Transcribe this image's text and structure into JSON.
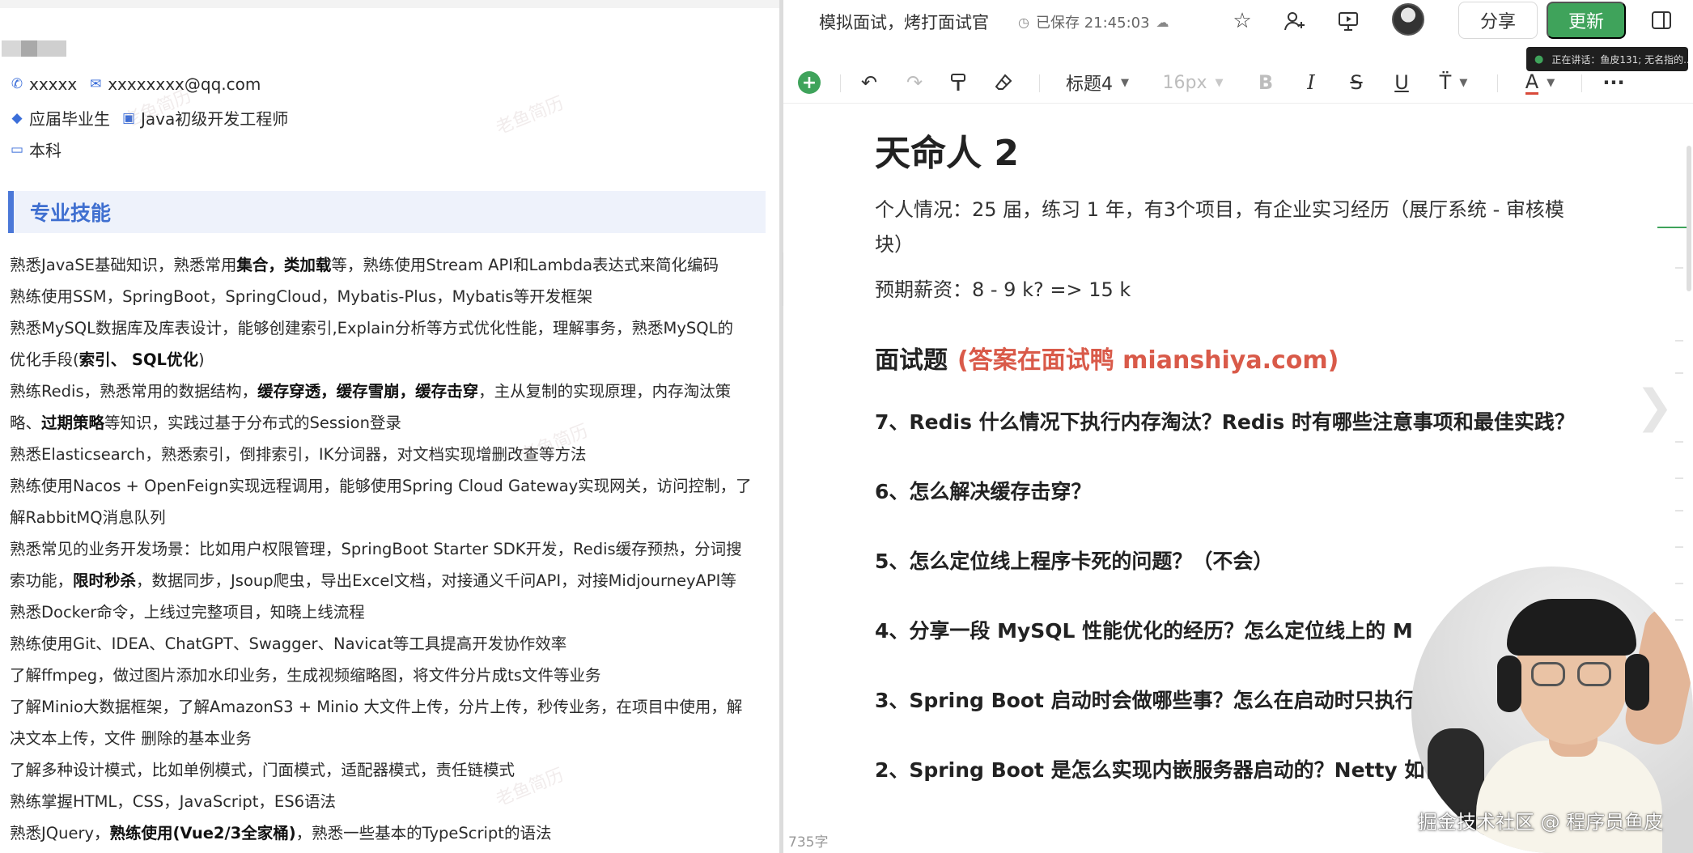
{
  "resume": {
    "contact": {
      "phone": "xxxxx",
      "email": "xxxxxxxx@qq.com",
      "status": "应届毕业生",
      "job_title": "Java初级开发工程师",
      "education": "本科"
    },
    "section_title": "专业技能",
    "watermark": "老鱼简历",
    "skills": [
      [
        {
          "t": "熟悉JavaSE基础知识，熟悉常用"
        },
        {
          "t": "集合，类加载",
          "b": true
        },
        {
          "t": "等，熟练使用Stream API和Lambda表达式来简化编码"
        }
      ],
      [
        {
          "t": "熟练使用SSM，SpringBoot，SpringCloud，Mybatis-Plus，Mybatis等开发框架"
        }
      ],
      [
        {
          "t": "熟悉MySQL数据库及库表设计，能够创建索引,Explain分析等方式优化性能，理解事务，熟悉MySQL的"
        }
      ],
      [
        {
          "t": "优化手段("
        },
        {
          "t": "索引、 SQL优化",
          "b": true
        },
        {
          "t": ")"
        }
      ],
      [
        {
          "t": "熟练Redis，熟悉常用的数据结构，"
        },
        {
          "t": "缓存穿透，缓存雪崩，缓存击穿",
          "b": true
        },
        {
          "t": "，主从复制的实现原理，内存淘汰策"
        }
      ],
      [
        {
          "t": "略、"
        },
        {
          "t": "过期策略",
          "b": true
        },
        {
          "t": "等知识，实践过基于分布式的Session登录"
        }
      ],
      [
        {
          "t": "熟悉Elasticsearch，熟悉索引，倒排索引，IK分词器，对文档实现增删改查等方法"
        }
      ],
      [
        {
          "t": "熟练使用Nacos + OpenFeign实现远程调用，能够使用Spring Cloud Gateway实现网关，访问控制，了"
        }
      ],
      [
        {
          "t": "解RabbitMQ消息队列"
        }
      ],
      [
        {
          "t": "熟悉常见的业务开发场景：比如用户权限管理，SpringBoot Starter SDK开发，Redis缓存预热，分词搜"
        }
      ],
      [
        {
          "t": "索功能，"
        },
        {
          "t": "限时秒杀",
          "b": true
        },
        {
          "t": "，数据同步，Jsoup爬虫，导出Excel文档，对接通义千问API，对接MidjourneyAPI等"
        }
      ],
      [
        {
          "t": "熟悉Docker命令，上线过完整项目，知晓上线流程"
        }
      ],
      [
        {
          "t": "熟练使用Git、IDEA、ChatGPT、Swagger、Navicat等工具提高开发协作效率"
        }
      ],
      [
        {
          "t": "了解ffmpeg，做过图片添加水印业务，生成视频缩略图，将文件分片成ts文件等业务"
        }
      ],
      [
        {
          "t": "了解Minio大数据框架，了解AmazonS3 + Minio 大文件上传，分片上传，秒传业务，在项目中使用，解"
        }
      ],
      [
        {
          "t": "决文本上传，文件 删除的基本业务"
        }
      ],
      [
        {
          "t": "了解多种设计模式，比如单例模式，门面模式，适配器模式，责任链模式"
        }
      ],
      [
        {
          "t": "熟练掌握HTML，CSS，JavaScript，ES6语法"
        }
      ],
      [
        {
          "t": "熟悉JQuery，"
        },
        {
          "t": "熟练使用(Vue2/3全家桶)",
          "b": true
        },
        {
          "t": "，熟悉一些基本的TypeScript的语法"
        }
      ]
    ]
  },
  "editor": {
    "title": "模拟面试，烤打面试官",
    "save_status": "已保存 21:45:03",
    "share_label": "分享",
    "update_label": "更新",
    "speaking_tip": "正在讲话：鱼皮131; 无名指的...",
    "toolbar": {
      "heading": "标题4",
      "font_size": "16px",
      "bold": "B",
      "italic": "I",
      "strike": "S",
      "underline": "U",
      "font_color": "A",
      "more": "···"
    },
    "doc": {
      "h1": "天命人 2",
      "personal": "个人情况：25 届，练习 1 年，有3个项目，有企业实习经历（展厅系统 - 审核模块）",
      "salary": "预期薪资：8 - 9 k?   => 15 k",
      "h2": "面试题",
      "h2_highlight": "(答案在面试鸭 mianshiya.com)",
      "questions": [
        "7、Redis 什么情况下执行内存淘汰？Redis 时有哪些注意事项和最佳实践？",
        "6、怎么解决缓存击穿？",
        "5、怎么定位线上程序卡死的问题？（不会）",
        "4、分享一段 MySQL 性能优化的经历？怎么定位线上的 M",
        "3、Spring Boot 启动时会做哪些事？怎么在启动时只执行",
        "2、Spring Boot 是怎么实现内嵌服务器启动的？Netty 如何"
      ]
    },
    "word_count": "735字"
  },
  "credit": "掘金技术社区 @ 程序员鱼皮",
  "colors": {
    "accent_green": "#3fa35b",
    "link_red": "#d95a49",
    "section_blue": "#3f6fd0"
  }
}
